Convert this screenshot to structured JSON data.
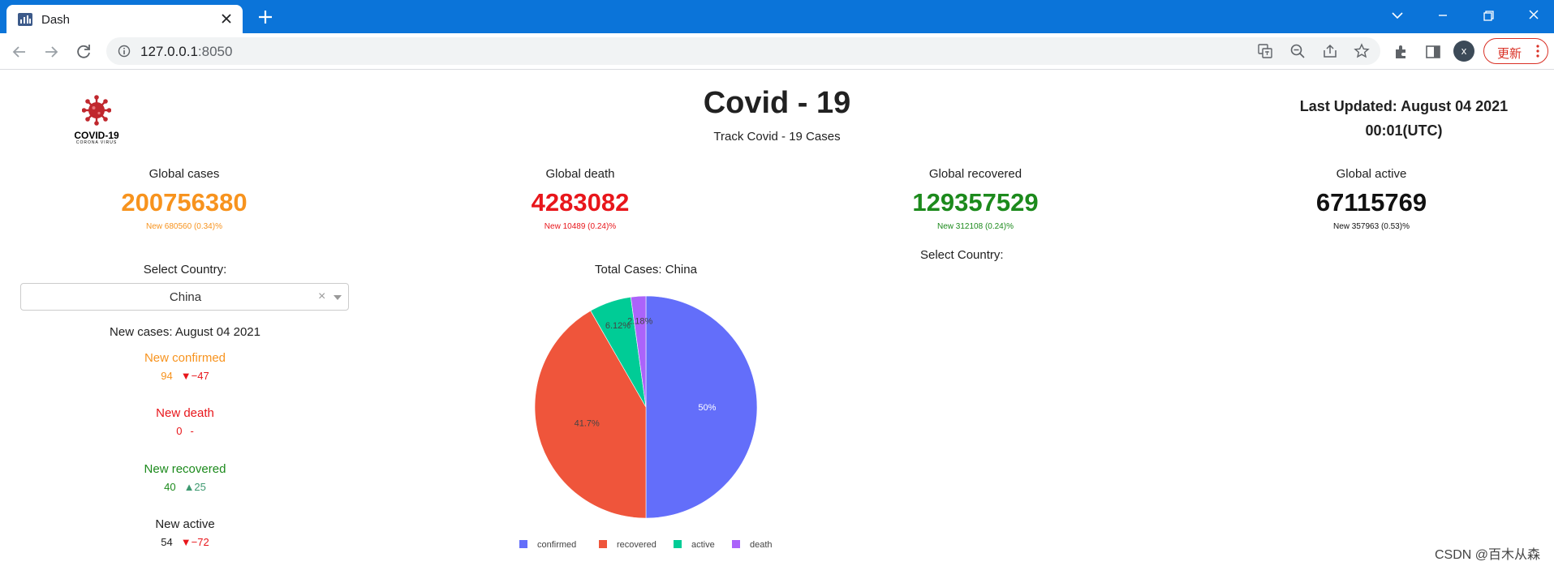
{
  "browser": {
    "tab_title": "Dash",
    "url_host": "127.0.0.1",
    "url_port": ":8050",
    "avatar_letter": "x",
    "update_label": "更新"
  },
  "header": {
    "logo_text": "COVID-19",
    "logo_subtext": "CORONA VIRUS",
    "title": "Covid - 19",
    "subtitle": "Track Covid - 19 Cases",
    "last_updated_line1": "Last Updated: August 04 2021",
    "last_updated_line2": "00:01(UTC)"
  },
  "global_cards": [
    {
      "label": "Global cases",
      "value": "200756380",
      "new": "New 680560 (0.34)%",
      "color": "#f7931e"
    },
    {
      "label": "Global death",
      "value": "4283082",
      "new": "New 10489 (0.24)%",
      "color": "#e8161b"
    },
    {
      "label": "Global recovered",
      "value": "129357529",
      "new": "New 312108 (0.24)%",
      "color": "#1c8a1c"
    },
    {
      "label": "Global active",
      "value": "67115769",
      "new": "New 357963 (0.53)%",
      "color": "#111111"
    }
  ],
  "left_panel": {
    "select_label": "Select Country:",
    "selected_country": "China",
    "clear_symbol": "×",
    "new_cases_title": "New cases: August 04 2021",
    "items": [
      {
        "label": "New confirmed",
        "value": "94",
        "delta": "▼−47",
        "label_color": "#f7931e",
        "value_color": "#f7931e",
        "delta_color": "#e8161b"
      },
      {
        "label": "New death",
        "value": "0",
        "delta": "-",
        "label_color": "#e8161b",
        "value_color": "#e8161b",
        "delta_color": "#e8161b"
      },
      {
        "label": "New recovered",
        "value": "40",
        "delta": "▲25",
        "label_color": "#1c8a1c",
        "value_color": "#1c8a1c",
        "delta_color": "#3d9970"
      },
      {
        "label": "New active",
        "value": "54",
        "delta": "▼−72",
        "label_color": "#212121",
        "value_color": "#212121",
        "delta_color": "#e8161b"
      }
    ]
  },
  "right_panel": {
    "select_label": "Select Country:"
  },
  "chart_data": {
    "type": "pie",
    "title": "Total Cases: China",
    "slices": [
      {
        "label": "confirmed",
        "value": 50,
        "text": "50%",
        "color": "#636efa"
      },
      {
        "label": "recovered",
        "value": 41.7,
        "text": "41.7%",
        "color": "#ef553b"
      },
      {
        "label": "active",
        "value": 6.12,
        "text": "6.12%",
        "color": "#00cc96"
      },
      {
        "label": "death",
        "value": 2.18,
        "text": "2.18%",
        "color": "#ab63fa"
      }
    ],
    "legend_position": "bottom"
  },
  "watermark": "CSDN @百木从森"
}
